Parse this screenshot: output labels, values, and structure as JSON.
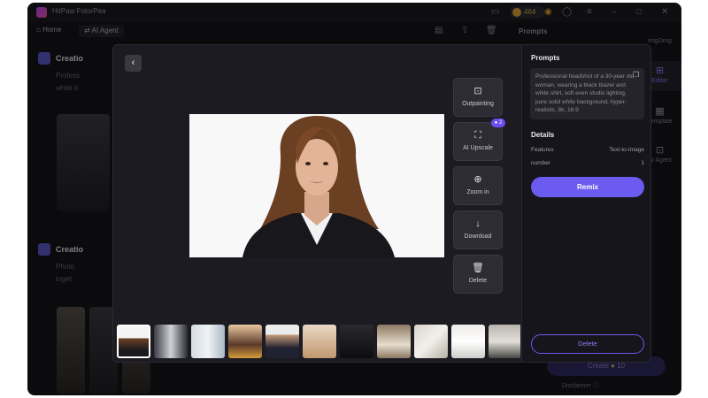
{
  "titlebar": {
    "app_name": "HitPaw FotorPea",
    "credits": "464"
  },
  "nav": {
    "home": "Home",
    "ai_agent": "AI Agent"
  },
  "background": {
    "section1_title": "Creatio",
    "section1_line1": "Profess",
    "section1_line2": "white b",
    "section2_title": "Creatio",
    "section2_line1": "Photo",
    "section2_line2": "toget",
    "prompts_heading": "Prompts",
    "create_label": "Create",
    "create_cost": "10",
    "disclaimer": "Disclaimer"
  },
  "right_sidebar": [
    {
      "label": "img2img",
      "icon": "image-icon"
    },
    {
      "label": "Editor",
      "icon": "editor-icon"
    },
    {
      "label": "Template",
      "icon": "template-icon"
    },
    {
      "label": "AI Agent",
      "icon": "agent-icon"
    }
  ],
  "modal": {
    "tools": [
      {
        "label": "Outpainting",
        "icon": "outpainting-icon"
      },
      {
        "label": "AI Upscale",
        "icon": "upscale-icon"
      },
      {
        "label": "Zoom in",
        "icon": "zoom-in-icon"
      },
      {
        "label": "Download",
        "icon": "download-icon"
      },
      {
        "label": "Delete",
        "icon": "trash-icon"
      }
    ],
    "upscale_badge": "2",
    "thumbnails_count": 11,
    "panel": {
      "prompts_heading": "Prompts",
      "prompt_text": "Professional headshot of a 30-year old woman, wearing a black blazer and white shirt, soft even studio lighting, pure solid white background, hyper-realistic, 8k, 16:9",
      "details_heading": "Details",
      "features_label": "Features",
      "features_value": "Text-to-Image",
      "number_label": "number",
      "number_value": "1",
      "remix_label": "Remix",
      "delete_label": "Delete"
    }
  },
  "colors": {
    "accent": "#6b5bf0",
    "background": "#141318",
    "panel": "#16151b"
  }
}
